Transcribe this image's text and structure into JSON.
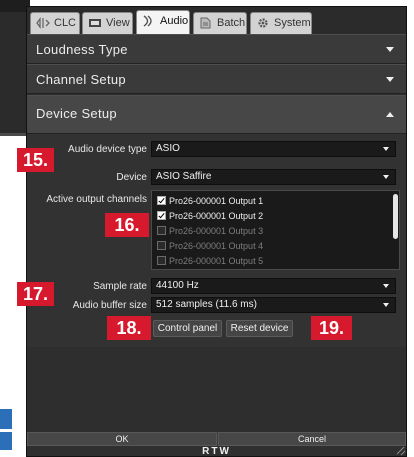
{
  "tabs": [
    {
      "label": "CLC",
      "icon": "clc-icon"
    },
    {
      "label": "View",
      "icon": "monitor-icon"
    },
    {
      "label": "Audio",
      "icon": "audio-signal-icon",
      "active": true
    },
    {
      "label": "Batch",
      "icon": "batch-icon"
    },
    {
      "label": "System",
      "icon": "gear-icon"
    }
  ],
  "sections": {
    "loudness_type": "Loudness Type",
    "channel_setup": "Channel Setup",
    "device_setup": "Device Setup"
  },
  "device": {
    "audio_device_type_label": "Audio device type",
    "audio_device_type_value": "ASIO",
    "device_label": "Device",
    "device_value": "ASIO Saffire",
    "active_output_label": "Active output channels",
    "channels": [
      {
        "label": "Pro26-000001 Output 1",
        "checked": true,
        "enabled": true
      },
      {
        "label": "Pro26-000001 Output 2",
        "checked": true,
        "enabled": true
      },
      {
        "label": "Pro26-000001 Output 3",
        "checked": false,
        "enabled": false
      },
      {
        "label": "Pro26-000001 Output 4",
        "checked": false,
        "enabled": false
      },
      {
        "label": "Pro26-000001 Output 5",
        "checked": false,
        "enabled": false
      }
    ],
    "sample_rate_label": "Sample rate",
    "sample_rate_value": "44100 Hz",
    "buffer_size_label": "Audio buffer size",
    "buffer_size_value": "512 samples (11.6 ms)",
    "control_panel_label": "Control panel",
    "reset_device_label": "Reset device"
  },
  "callouts": {
    "c15": "15.",
    "c16": "16.",
    "c17": "17.",
    "c18": "18.",
    "c19": "19."
  },
  "footer": {
    "ok_label": "OK",
    "cancel_label": "Cancel",
    "brand": "RTW"
  },
  "colors": {
    "callout": "#d7192e",
    "panel": "#323232"
  }
}
